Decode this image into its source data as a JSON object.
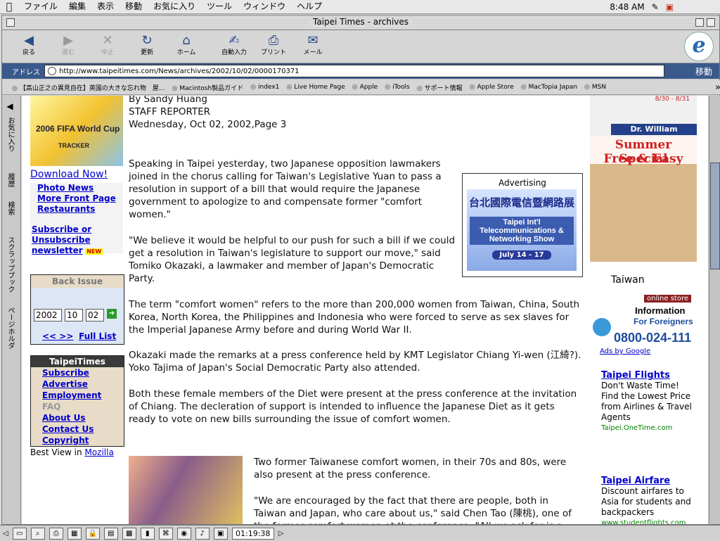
{
  "menubar": {
    "items": [
      "ファイル",
      "編集",
      "表示",
      "移動",
      "お気に入り",
      "ツール",
      "ウィンドウ",
      "ヘルプ"
    ],
    "clock": "8:48 AM"
  },
  "window": {
    "title": "Taipei Times - archives"
  },
  "toolbar": {
    "back": "戻る",
    "forward": "進む",
    "stop": "中止",
    "refresh": "更新",
    "home": "ホーム",
    "autofill": "自動入力",
    "print": "プリント",
    "mail": "メール"
  },
  "address": {
    "label": "アドレス",
    "url": "http://www.taipeitimes.com/News/archives/2002/10/02/0000170371",
    "go": "移動"
  },
  "favorites": [
    "【高山正之の異見自在】英国の大きな忘れ物　屋...",
    "Macintosh製品ガイド",
    "index1",
    "Live Home Page",
    "Apple",
    "iTools",
    "サポート情報",
    "Apple Store",
    "MacTopia Japan",
    "MSN"
  ],
  "sidetabs": [
    "お気に入り",
    "履歴",
    "検索",
    "スクラップブック",
    "ページホルダ"
  ],
  "left": {
    "banner_title": "2006 FIFA World Cup",
    "banner_sub": "TRACKER",
    "download": "Download Now!",
    "links": [
      "Photo News",
      "More Front Page",
      "Restaurants"
    ],
    "subscribe": "Subscribe or Unsubscribe newsletter",
    "new_badge": "NEW",
    "back_issue": {
      "title": "Back Issue",
      "year": "2002",
      "month": "10",
      "day": "02",
      "prevnext": "<< >>",
      "full_list": "Full List"
    },
    "taipeitimes": {
      "title": "TaipeiTimes",
      "links": [
        "Subscribe",
        "Advertise",
        "Employment"
      ],
      "faq": "FAQ",
      "links2": [
        "About Us",
        "Contact Us",
        "Copyright"
      ]
    },
    "best_view": "Best View in",
    "mozilla": "Mozilla"
  },
  "article": {
    "byline": "By Sandy Huang",
    "role": "STAFF REPORTER",
    "date": "Wednesday, Oct 02, 2002,Page 3",
    "p1": "Speaking in Taipei yesterday, two Japanese opposition lawmakers joined in the chorus calling for Taiwan's Legislative Yuan to pass a resolution in support of a bill that would require the Japanese government to apologize to and compensate former \"comfort women.\"",
    "p2": "\"We believe it would be helpful to our push for such a bill if we could get a resolution in Taiwan's legislature to support our move,\" said Tomiko Okazaki, a lawmaker and member of Japan's Democratic Party.",
    "p3": "The term \"comfort women\" refers to the more than 200,000 women from Taiwan, China, South Korea, North Korea, the Philippines and Indonesia who were forced to serve as sex slaves for the Imperial Japanese Army before and during World War II.",
    "p4": "Okazaki made the remarks at a press conference held by KMT Legislator Chiang Yi-wen (江綺?). Yoko Tajima of Japan's Social Democratic Party also attended.",
    "p5": "Both these female members of the Diet were present at the press conference at the invitation of Chiang. The decleration of support is intended to influence the Japanese Diet as it gets ready to vote on new bills surrounding the issue of comfort women.",
    "p6": "Two former Taiwanese comfort women, in their 70s and 80s, were also present at the press conference.",
    "p7": "\"We are encouraged by the fact that there are people, both in Taiwan and Japan, who care about us,\" said Chen Tao (陳桃), one of the former comfort women at the conference. \"All we ask for is a formal apology from the Japanese government.\""
  },
  "ad": {
    "caption": "Advertising",
    "cn_title": "台北國際電信暨網路展",
    "en_title": "Taipei Int'l Telecommunications & Networking Show",
    "dates": "July 14 - 17"
  },
  "right": {
    "dates": "8/30 - 8/31",
    "doctor": "Dr. William Rothwell",
    "summer": "Summer Special",
    "free": "Free & Easy",
    "taiwan": "Taiwan",
    "online": "online store",
    "info": "Information",
    "foreigners": "For Foreigners",
    "phone": "0800-024-111",
    "ads_by": "Ads by Google",
    "gads": [
      {
        "title": "Taipei Flights",
        "body": "Don't Waste Time! Find the Lowest Price from Airlines & Travel Agents",
        "url": "Taipei.OneTime.com"
      },
      {
        "title": "Taipei Airfare",
        "body": "Discount airfares to Asia for students and backpackers",
        "url": "www.studentflights.com"
      }
    ]
  },
  "statusbar": {
    "timer": "01:19:38"
  }
}
